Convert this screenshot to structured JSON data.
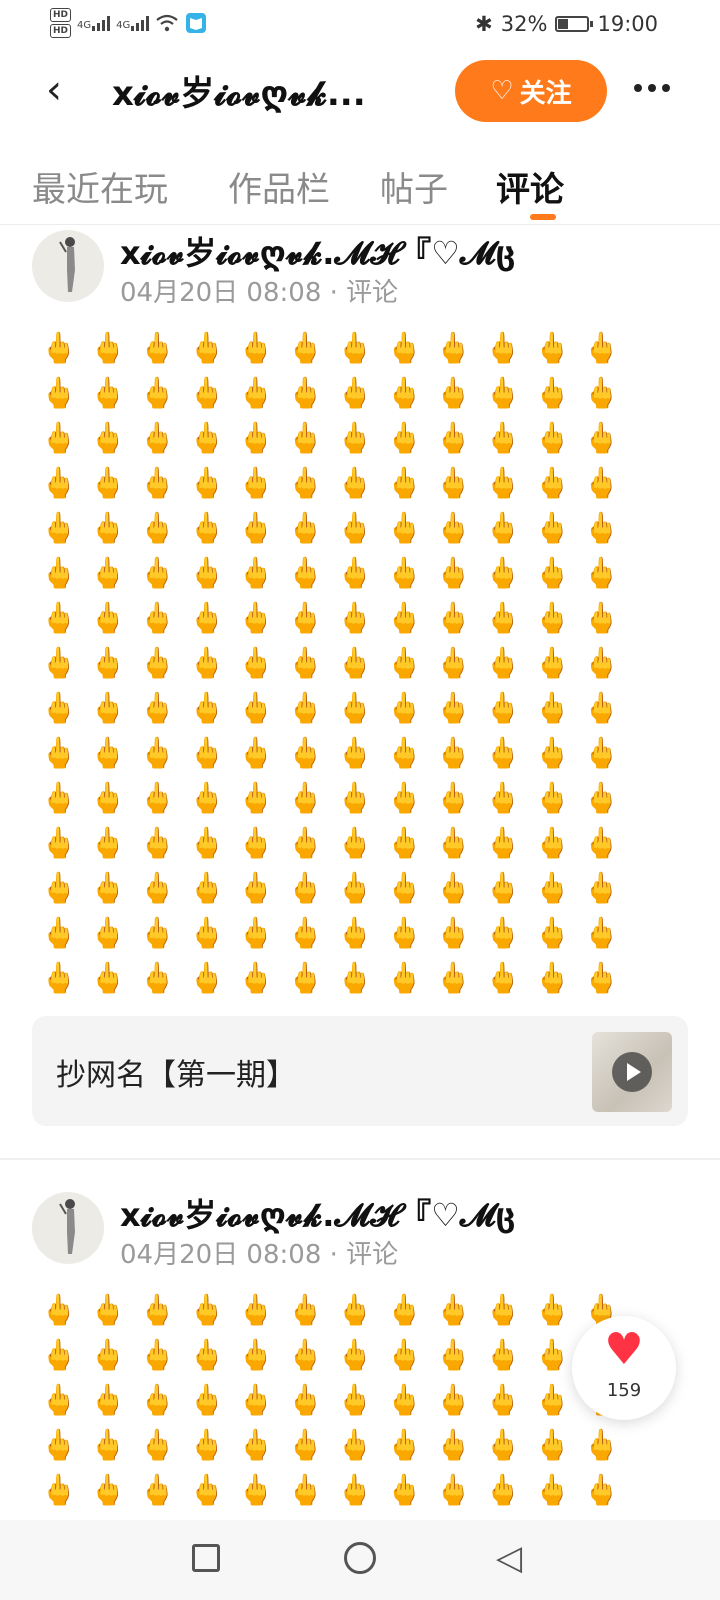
{
  "status_bar": {
    "hd1": "HD",
    "hd2": "HD",
    "net1": "4G",
    "net2": "4G",
    "battery_pct": "32%",
    "time": "19:00",
    "bluetooth_glyph": "✱",
    "battery_level": 0.32
  },
  "header": {
    "back_glyph": "‹",
    "title": "x𝓲𝓸𝓿岁𝓲𝓸𝓿ღ𝓿𝓴...",
    "follow_label": "关注",
    "follow_icon": "♡"
  },
  "tabs": [
    {
      "label": "最近在玩"
    },
    {
      "label": "作品栏"
    },
    {
      "label": "帖子"
    },
    {
      "label": "评论"
    }
  ],
  "posts": [
    {
      "author": "x𝓲𝓸𝓿岁𝓲𝓸𝓿ღ𝓿𝓴.𝓜𝓗『♡𝓜ც",
      "meta": "04月20日 08:08 · 评论",
      "emoji_text": "🖕🖕🖕🖕🖕🖕🖕🖕🖕🖕🖕🖕🖕🖕🖕🖕🖕🖕🖕🖕🖕🖕🖕🖕🖕🖕🖕🖕🖕🖕🖕🖕🖕🖕🖕🖕🖕🖕🖕🖕🖕🖕🖕🖕🖕🖕🖕🖕🖕🖕🖕🖕🖕🖕🖕🖕🖕🖕🖕🖕🖕🖕🖕🖕🖕🖕🖕🖕🖕🖕🖕🖕🖕🖕🖕🖕🖕🖕🖕🖕🖕🖕🖕🖕🖕🖕🖕🖕🖕🖕🖕🖕🖕🖕🖕🖕🖕🖕🖕🖕🖕🖕🖕🖕🖕🖕🖕🖕🖕🖕🖕🖕🖕🖕🖕🖕🖕🖕🖕🖕🖕🖕🖕🖕🖕🖕🖕🖕🖕🖕🖕🖕🖕🖕🖕🖕🖕🖕🖕🖕🖕🖕🖕🖕🖕🖕🖕🖕🖕🖕🖕🖕🖕🖕🖕🖕🖕🖕🖕🖕🖕🖕🖕🖕🖕🖕🖕🖕🖕🖕🖕🖕🖕🖕🖕🖕🖕🖕🖕🖕🖕🖕🖕🖕🖕🖕🖕🖕🖕🖕🖕🖕🖕🖕🖕🖕🖕🖕🖕🖕🖕🖕🖕🖕🖕🖕🖕🖕🖕🖕🖕🖕🖕🖕🖕🖕🖕🖕🖕🖕",
      "card_title": "抄网名【第一期】"
    },
    {
      "author": "x𝓲𝓸𝓿岁𝓲𝓸𝓿ღ𝓿𝓴.𝓜𝓗『♡𝓜ც",
      "meta": "04月20日 08:08 · 评论",
      "emoji_text": "🖕🖕🖕🖕🖕🖕🖕🖕🖕🖕🖕🖕🖕🖕🖕🖕🖕🖕🖕🖕🖕🖕🖕🖕🖕🖕🖕🖕🖕🖕🖕🖕🖕🖕🖕🖕🖕🖕🖕🖕🖕🖕🖕🖕🖕🖕🖕🖕🖕🖕🖕🖕🖕🖕🖕🖕🖕🖕🖕🖕🖕🖕🖕🖕🖕🖕🖕🖕🖕🖕"
    }
  ],
  "like": {
    "icon": "♥",
    "count": "159"
  },
  "nav": {
    "back_glyph": "◁"
  },
  "colors": {
    "accent": "#ff7a1a",
    "like": "#ff3344"
  }
}
